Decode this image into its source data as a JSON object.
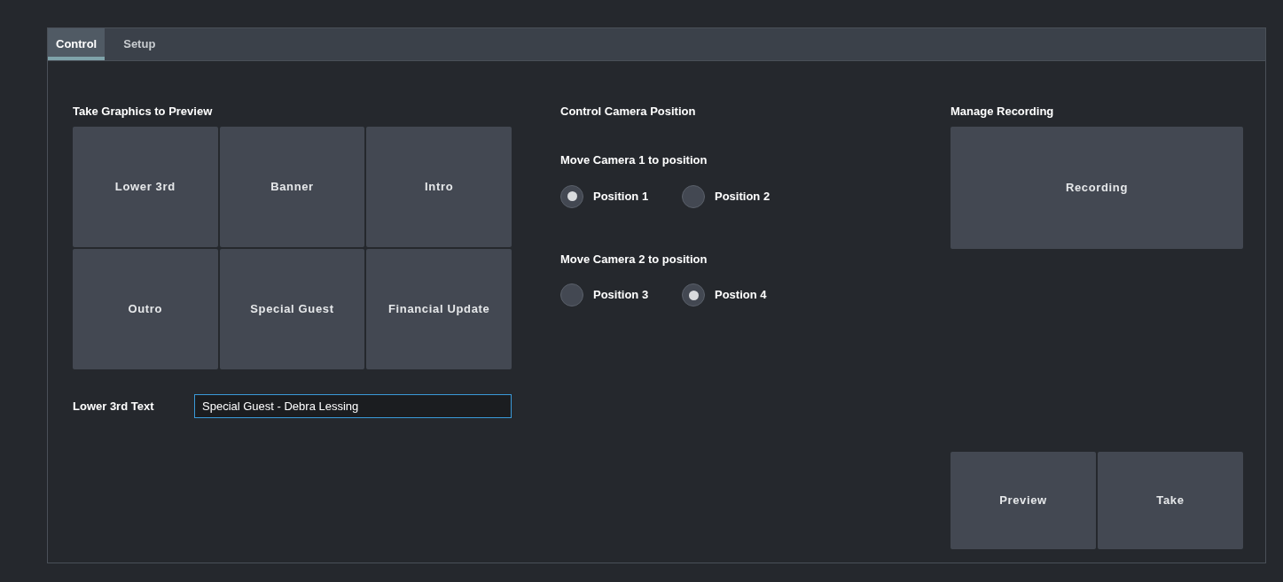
{
  "tabs": [
    {
      "label": "Control",
      "selected": true
    },
    {
      "label": "Setup",
      "selected": false
    }
  ],
  "graphics": {
    "title": "Take Graphics to Preview",
    "buttons": [
      "Lower 3rd",
      "Banner",
      "Intro",
      "Outro",
      "Special Guest",
      "Financial Update"
    ],
    "field_label": "Lower 3rd Text",
    "field_value": "Special Guest - Debra Lessing"
  },
  "camera": {
    "title": "Control Camera Position",
    "groups": [
      {
        "label": "Move Camera 1 to position",
        "options": [
          {
            "label": "Position 1",
            "selected": true
          },
          {
            "label": "Position 2",
            "selected": false
          }
        ]
      },
      {
        "label": "Move Camera 2 to position",
        "options": [
          {
            "label": "Position 3",
            "selected": false
          },
          {
            "label": "Postion 4",
            "selected": true
          }
        ]
      }
    ]
  },
  "recording": {
    "title": "Manage Recording",
    "button": "Recording",
    "actions": [
      "Preview",
      "Take"
    ]
  }
}
